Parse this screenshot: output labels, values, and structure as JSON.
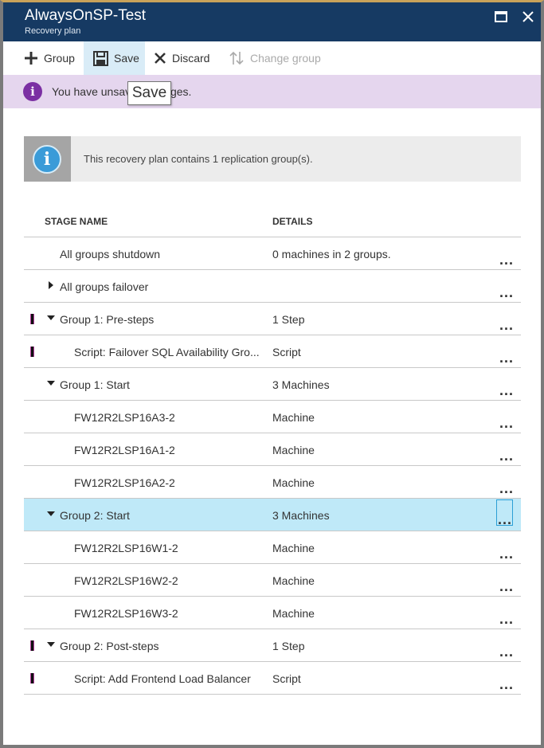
{
  "window": {
    "title": "AlwaysOnSP-Test",
    "subtitle": "Recovery plan"
  },
  "toolbar": {
    "group_label": "Group",
    "save_label": "Save",
    "discard_label": "Discard",
    "change_group_label": "Change group"
  },
  "banner": {
    "message": "You have unsaved changes.",
    "tooltip": "Save"
  },
  "notice": {
    "text": "This recovery plan contains 1 replication group(s)."
  },
  "grid": {
    "columns": {
      "stage_name": "STAGE NAME",
      "details": "DETAILS"
    },
    "rows": [
      {
        "name": "All groups shutdown",
        "details": "0 machines in 2 groups.",
        "indent": 1,
        "expander": "none",
        "marker": false,
        "selected": false
      },
      {
        "name": "All groups failover",
        "details": "",
        "indent": 1,
        "expander": "collapsed",
        "marker": false,
        "selected": false
      },
      {
        "name": "Group 1: Pre-steps",
        "details": "1 Step",
        "indent": 1,
        "expander": "expanded",
        "marker": true,
        "selected": false
      },
      {
        "name": "Script: Failover SQL Availability Gro...",
        "details": "Script",
        "indent": 2,
        "expander": "none",
        "marker": true,
        "selected": false
      },
      {
        "name": "Group 1: Start",
        "details": "3 Machines",
        "indent": 1,
        "expander": "expanded",
        "marker": false,
        "selected": false
      },
      {
        "name": "FW12R2LSP16A3-2",
        "details": "Machine",
        "indent": 2,
        "expander": "none",
        "marker": false,
        "selected": false
      },
      {
        "name": "FW12R2LSP16A1-2",
        "details": "Machine",
        "indent": 2,
        "expander": "none",
        "marker": false,
        "selected": false
      },
      {
        "name": "FW12R2LSP16A2-2",
        "details": "Machine",
        "indent": 2,
        "expander": "none",
        "marker": false,
        "selected": false
      },
      {
        "name": "Group 2: Start",
        "details": "3 Machines",
        "indent": 1,
        "expander": "expanded",
        "marker": false,
        "selected": true
      },
      {
        "name": "FW12R2LSP16W1-2",
        "details": "Machine",
        "indent": 2,
        "expander": "none",
        "marker": false,
        "selected": false
      },
      {
        "name": "FW12R2LSP16W2-2",
        "details": "Machine",
        "indent": 2,
        "expander": "none",
        "marker": false,
        "selected": false
      },
      {
        "name": "FW12R2LSP16W3-2",
        "details": "Machine",
        "indent": 2,
        "expander": "none",
        "marker": false,
        "selected": false
      },
      {
        "name": "Group 2: Post-steps",
        "details": "1 Step",
        "indent": 1,
        "expander": "expanded",
        "marker": true,
        "selected": false
      },
      {
        "name": "Script: Add Frontend Load Balancer",
        "details": "Script",
        "indent": 2,
        "expander": "none",
        "marker": true,
        "selected": false
      }
    ]
  },
  "icons": {
    "more": "more-icon",
    "expanded": "caret-down-icon",
    "collapsed": "caret-right-icon"
  },
  "colors": {
    "titlebar": "#163a63",
    "banner": "#e5d6ee",
    "info_purple": "#7b2fa3",
    "selected_row": "#bfe9f8",
    "save_highlight": "#d9ecf7"
  }
}
